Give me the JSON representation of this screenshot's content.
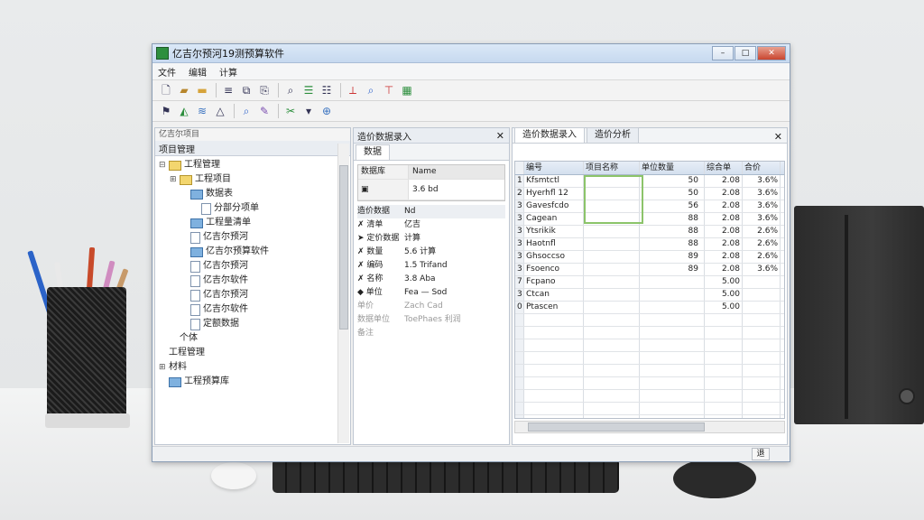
{
  "window": {
    "title": "亿吉尔预河19测预算软件"
  },
  "menu": [
    "文件",
    "编辑",
    "计算"
  ],
  "toolbar1": [
    "new-icon",
    "open-icon",
    "save-icon",
    "cut-icon",
    "copy-icon",
    "paste-icon",
    "search-icon",
    "list-icon",
    "table-icon",
    "chart-icon",
    "zoom-icon",
    "pin-icon",
    "calc-icon"
  ],
  "toolbar2": [
    "flag-icon",
    "hat-icon",
    "stack-icon",
    "bell-icon",
    "zoom-icon",
    "edit-icon",
    "tools-icon",
    "filter-icon",
    "globe-icon"
  ],
  "left_panel": {
    "title": "项目管理",
    "subtitle": "亿吉尔项目",
    "tree": [
      {
        "label": "工程管理",
        "depth": 0,
        "icon": "folder",
        "exp": "⊟"
      },
      {
        "label": "工程项目",
        "depth": 1,
        "icon": "folder",
        "exp": "⊞"
      },
      {
        "label": "数据表",
        "depth": 2,
        "icon": "blue",
        "exp": ""
      },
      {
        "label": "分部分项单",
        "depth": 3,
        "icon": "doc",
        "exp": ""
      },
      {
        "label": "工程量清单",
        "depth": 2,
        "icon": "blue",
        "exp": ""
      },
      {
        "label": "亿吉尔预河",
        "depth": 2,
        "icon": "doc",
        "exp": ""
      },
      {
        "label": "亿吉尔预算软件",
        "depth": 2,
        "icon": "blue",
        "exp": ""
      },
      {
        "label": "亿吉尔预河",
        "depth": 2,
        "icon": "doc",
        "exp": ""
      },
      {
        "label": "亿吉尔软件",
        "depth": 2,
        "icon": "doc",
        "exp": ""
      },
      {
        "label": "亿吉尔预河",
        "depth": 2,
        "icon": "doc",
        "exp": ""
      },
      {
        "label": "亿吉尔软件",
        "depth": 2,
        "icon": "doc",
        "exp": ""
      },
      {
        "label": "定额数据",
        "depth": 2,
        "icon": "doc",
        "exp": ""
      },
      {
        "label": "个体",
        "depth": 1,
        "icon": "none",
        "exp": ""
      },
      {
        "label": "工程管理",
        "depth": 0,
        "icon": "none",
        "exp": ""
      },
      {
        "label": "材料",
        "depth": 0,
        "icon": "none",
        "exp": "⊞"
      },
      {
        "label": "工程预算库",
        "depth": 0,
        "icon": "blue",
        "exp": ""
      }
    ]
  },
  "mid_panel": {
    "title": "造价数据录入",
    "tab": "数据",
    "props": [
      [
        "数据库",
        "Name"
      ],
      [
        "▣",
        "3.6 bd"
      ]
    ],
    "header": [
      "造价数据",
      "Nd"
    ],
    "rows": [
      [
        "✗ 清单",
        "亿吉"
      ],
      [
        "➤ 定价数据",
        "计算"
      ],
      [
        "✗ 数量",
        "5.6 计算"
      ],
      [
        "✗ 编码",
        "1.5 Trifand"
      ],
      [
        "✗ 名称",
        "3.8 Aba"
      ],
      [
        "◆ 单位",
        "Fea — Sod"
      ],
      [
        "单价",
        "Zach Cad"
      ],
      [
        "数据单位",
        "ToePhaes 利润"
      ],
      [
        "备注",
        ""
      ]
    ]
  },
  "right_panel": {
    "tabs": [
      "造价数据录入",
      "造价分析"
    ],
    "columns": [
      "编号",
      "项目名称",
      "单位数量",
      "综合单",
      "合价"
    ],
    "rows": [
      [
        "1",
        "Kfsmtctl",
        "",
        "50",
        "2.08",
        "3.6%"
      ],
      [
        "2",
        "Hyerhfl 12",
        "",
        "50",
        "2.08",
        "3.6%"
      ],
      [
        "3",
        "Gavesfcdo",
        "",
        "56",
        "2.08",
        "3.6%"
      ],
      [
        "3",
        "Cagean",
        "",
        "88",
        "2.08",
        "3.6%"
      ],
      [
        "3",
        "Ytsrikik",
        "",
        "88",
        "2.08",
        "2.6%"
      ],
      [
        "3",
        "Haotnfl",
        "",
        "88",
        "2.08",
        "2.6%"
      ],
      [
        "3",
        "Ghsoccso",
        "",
        "89",
        "2.08",
        "2.6%"
      ],
      [
        "3",
        "Fsoenco",
        "",
        "89",
        "2.08",
        "3.6%"
      ],
      [
        "7",
        "Fcpano",
        "",
        "",
        "5.00",
        ""
      ],
      [
        "3",
        "Ctcan",
        "",
        "",
        "5.00",
        ""
      ],
      [
        "0",
        "Ptascen",
        "",
        "",
        "5.00",
        ""
      ]
    ],
    "empty_rows": 10
  },
  "statusbar": {
    "button": "退"
  }
}
